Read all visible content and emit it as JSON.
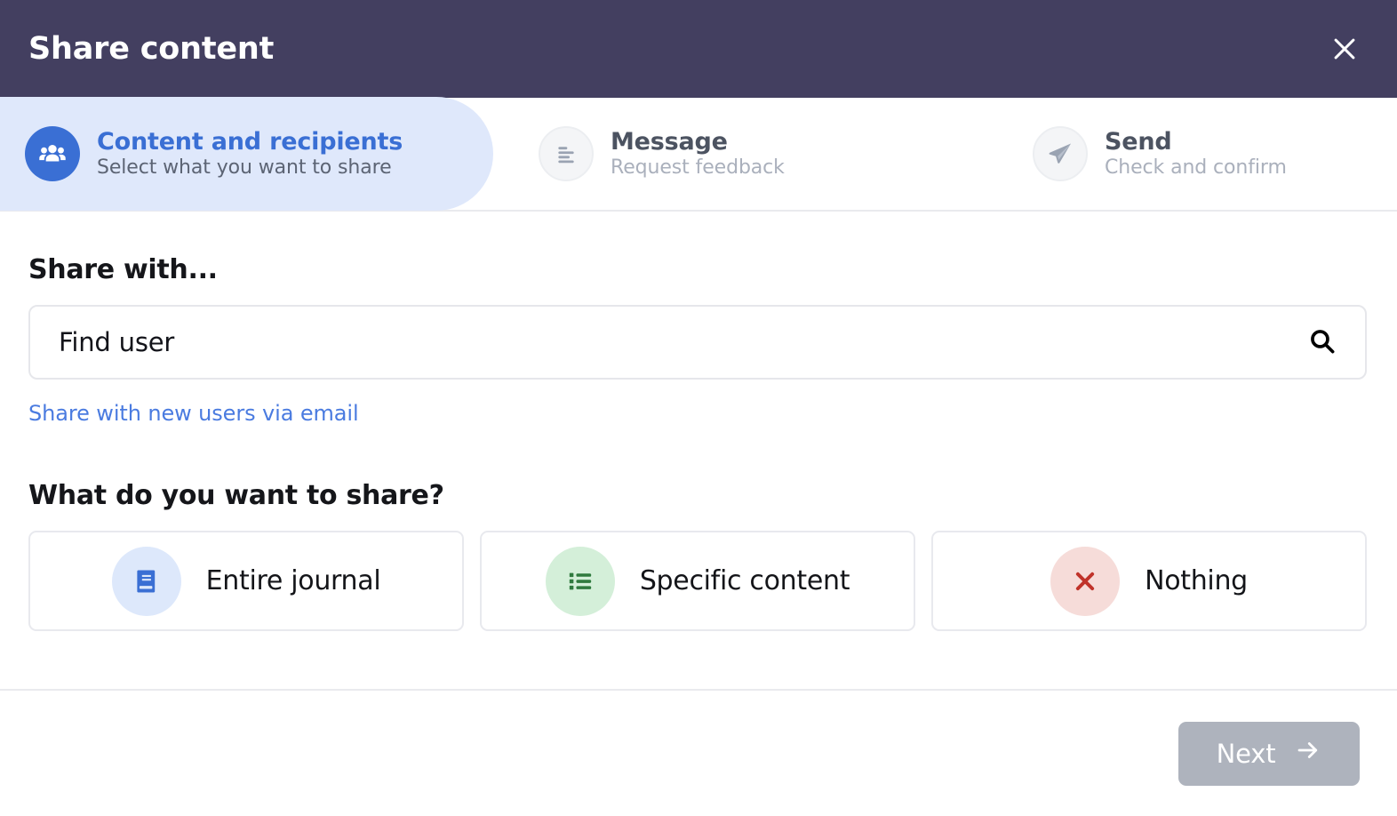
{
  "header": {
    "title": "Share content",
    "close_icon": "close-icon"
  },
  "stepper": {
    "steps": [
      {
        "label": "Content and recipients",
        "sublabel": "Select what you want to share",
        "icon": "people-group-icon",
        "state": "active"
      },
      {
        "label": "Message",
        "sublabel": "Request feedback",
        "icon": "text-lines-icon",
        "state": "inactive"
      },
      {
        "label": "Send",
        "sublabel": "Check and confirm",
        "icon": "paper-plane-icon",
        "state": "inactive"
      }
    ]
  },
  "share_with": {
    "title": "Share with...",
    "search_value": "Find user",
    "search_placeholder": "Find user",
    "search_icon": "search-icon",
    "email_link": "Share with new users via email"
  },
  "what_to_share": {
    "title": "What do you want to share?",
    "options": [
      {
        "label": "Entire journal",
        "icon": "book-icon",
        "icon_color": "#3a6fd4",
        "bg_color": "#dde8fb"
      },
      {
        "label": "Specific content",
        "icon": "list-icon",
        "icon_color": "#2f7a3e",
        "bg_color": "#d4efd9"
      },
      {
        "label": "Nothing",
        "icon": "x-mark-icon",
        "icon_color": "#c0332a",
        "bg_color": "#f6dcd9"
      }
    ]
  },
  "footer": {
    "next_label": "Next",
    "next_icon": "arrow-right-icon"
  },
  "colors": {
    "header_bg": "#433F60",
    "accent_blue": "#3a6fd4",
    "active_step_bg": "#dfe8fb",
    "link_blue": "#4a7be0",
    "disabled_button": "#aeb3bd"
  }
}
